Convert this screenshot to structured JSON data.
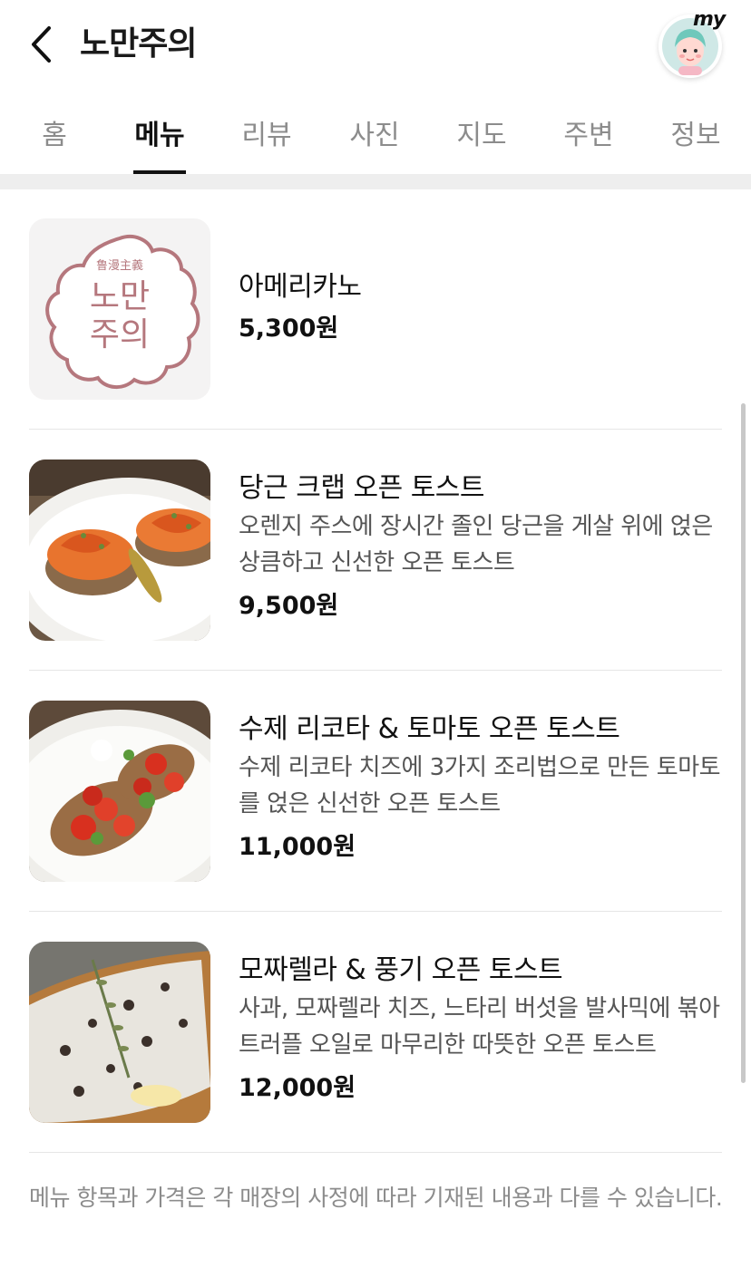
{
  "header": {
    "title": "노만주의",
    "back_icon": "chevron-left-icon",
    "my_badge": "my"
  },
  "tabs": [
    {
      "label": "홈",
      "active": false
    },
    {
      "label": "메뉴",
      "active": true
    },
    {
      "label": "리뷰",
      "active": false
    },
    {
      "label": "사진",
      "active": false
    },
    {
      "label": "지도",
      "active": false
    },
    {
      "label": "주변",
      "active": false
    },
    {
      "label": "정보",
      "active": false
    }
  ],
  "menu": [
    {
      "name": "아메리카노",
      "description": "",
      "price": "5,300원",
      "logo_text": [
        "鲁漫主義",
        "노만",
        "주의"
      ]
    },
    {
      "name": "당근 크랩 오픈 토스트",
      "description": "오렌지 주스에 장시간 졸인 당근을 게살 위에 얹은 상큼하고 신선한 오픈 토스트",
      "price": "9,500원"
    },
    {
      "name": "수제 리코타 & 토마토 오픈 토스트",
      "description": "수제 리코타 치즈에 3가지 조리법으로 만든 토마토를 얹은 신선한 오픈 토스트",
      "price": "11,000원"
    },
    {
      "name": "모짜렐라 & 풍기 오픈 토스트",
      "description": "사과, 모짜렐라 치즈, 느타리 버섯을 발사믹에 볶아 트러플 오일로 마무리한 따뜻한 오픈 토스트",
      "price": "12,000원"
    }
  ],
  "notice": "메뉴 항목과 가격은 각 매장의 사정에 따라 기재된 내용과 다를 수 있습니다.",
  "colors": {
    "logo": "#b5777d",
    "tab_active": "#111111",
    "tab_inactive": "#8c8c8c"
  }
}
